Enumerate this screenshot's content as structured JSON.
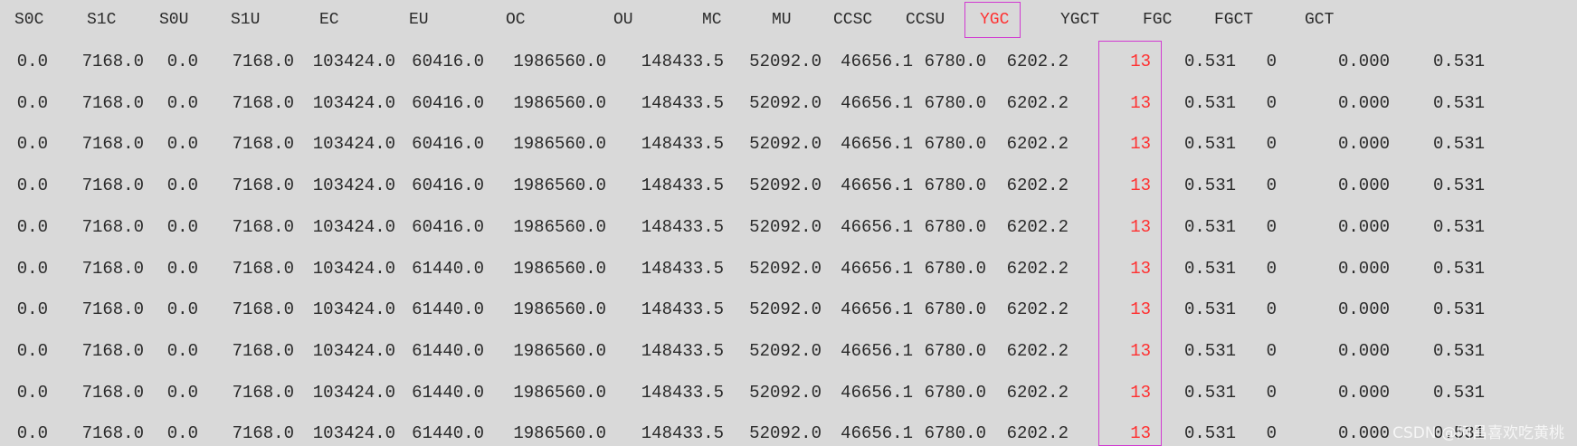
{
  "headers": [
    "S0C",
    "S1C",
    "S0U",
    "S1U",
    "EC",
    "EU",
    "OC",
    "OU",
    "MC",
    "MU",
    "CCSC",
    "CCSU",
    "YGC",
    "YGCT",
    "FGC",
    "FGCT",
    "GCT"
  ],
  "rows": [
    [
      "0.0",
      "7168.0",
      "0.0",
      "7168.0",
      "103424.0",
      "60416.0",
      "1986560.0",
      "148433.5",
      "52092.0",
      "46656.1",
      "6780.0",
      "6202.2",
      "13",
      "0.531",
      "0",
      "0.000",
      "0.531"
    ],
    [
      "0.0",
      "7168.0",
      "0.0",
      "7168.0",
      "103424.0",
      "60416.0",
      "1986560.0",
      "148433.5",
      "52092.0",
      "46656.1",
      "6780.0",
      "6202.2",
      "13",
      "0.531",
      "0",
      "0.000",
      "0.531"
    ],
    [
      "0.0",
      "7168.0",
      "0.0",
      "7168.0",
      "103424.0",
      "60416.0",
      "1986560.0",
      "148433.5",
      "52092.0",
      "46656.1",
      "6780.0",
      "6202.2",
      "13",
      "0.531",
      "0",
      "0.000",
      "0.531"
    ],
    [
      "0.0",
      "7168.0",
      "0.0",
      "7168.0",
      "103424.0",
      "60416.0",
      "1986560.0",
      "148433.5",
      "52092.0",
      "46656.1",
      "6780.0",
      "6202.2",
      "13",
      "0.531",
      "0",
      "0.000",
      "0.531"
    ],
    [
      "0.0",
      "7168.0",
      "0.0",
      "7168.0",
      "103424.0",
      "60416.0",
      "1986560.0",
      "148433.5",
      "52092.0",
      "46656.1",
      "6780.0",
      "6202.2",
      "13",
      "0.531",
      "0",
      "0.000",
      "0.531"
    ],
    [
      "0.0",
      "7168.0",
      "0.0",
      "7168.0",
      "103424.0",
      "61440.0",
      "1986560.0",
      "148433.5",
      "52092.0",
      "46656.1",
      "6780.0",
      "6202.2",
      "13",
      "0.531",
      "0",
      "0.000",
      "0.531"
    ],
    [
      "0.0",
      "7168.0",
      "0.0",
      "7168.0",
      "103424.0",
      "61440.0",
      "1986560.0",
      "148433.5",
      "52092.0",
      "46656.1",
      "6780.0",
      "6202.2",
      "13",
      "0.531",
      "0",
      "0.000",
      "0.531"
    ],
    [
      "0.0",
      "7168.0",
      "0.0",
      "7168.0",
      "103424.0",
      "61440.0",
      "1986560.0",
      "148433.5",
      "52092.0",
      "46656.1",
      "6780.0",
      "6202.2",
      "13",
      "0.531",
      "0",
      "0.000",
      "0.531"
    ],
    [
      "0.0",
      "7168.0",
      "0.0",
      "7168.0",
      "103424.0",
      "61440.0",
      "1986560.0",
      "148433.5",
      "52092.0",
      "46656.1",
      "6780.0",
      "6202.2",
      "13",
      "0.531",
      "0",
      "0.000",
      "0.531"
    ],
    [
      "0.0",
      "7168.0",
      "0.0",
      "7168.0",
      "103424.0",
      "61440.0",
      "1986560.0",
      "148433.5",
      "52092.0",
      "46656.1",
      "6780.0",
      "6202.2",
      "13",
      "0.531",
      "0",
      "0.000",
      "0.531"
    ]
  ],
  "highlight_column": "YGC",
  "colors": {
    "background": "#d9d9d9",
    "text": "#2a2a2a",
    "highlight_text": "#ff3030",
    "highlight_box": "#d13ad1"
  },
  "watermark": "CSDN @阿昌喜欢吃黄桃"
}
